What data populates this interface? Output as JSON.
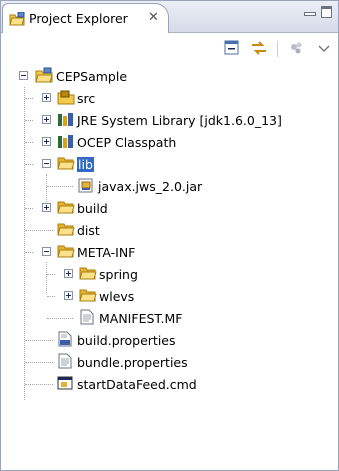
{
  "view": {
    "title": "Project Explorer",
    "close_glyph": "✕",
    "icons": {
      "tab": "project-explorer-icon",
      "minimize": "minimize-icon",
      "maximize": "maximize-icon",
      "collapse_all": "collapse-all-icon",
      "link_editor": "link-with-editor-icon",
      "filters": "filters-icon",
      "view_menu": "chevron-down-icon"
    }
  },
  "tree": {
    "project": "CEPSample",
    "src": "src",
    "jre": "JRE System Library [jdk1.6.0_13]",
    "ocep": "OCEP Classpath",
    "lib": "lib",
    "jar": "javax.jws_2.0.jar",
    "build": "build",
    "dist": "dist",
    "meta_inf": "META-INF",
    "spring": "spring",
    "wlevs": "wlevs",
    "manifest": "MANIFEST.MF",
    "build_properties": "build.properties",
    "bundle_properties": "bundle.properties",
    "start_cmd": "startDataFeed.cmd"
  },
  "selected": "lib",
  "colors": {
    "selection": "#316ac5",
    "folder": "#f3c94b",
    "library": "#2c6b2f"
  }
}
